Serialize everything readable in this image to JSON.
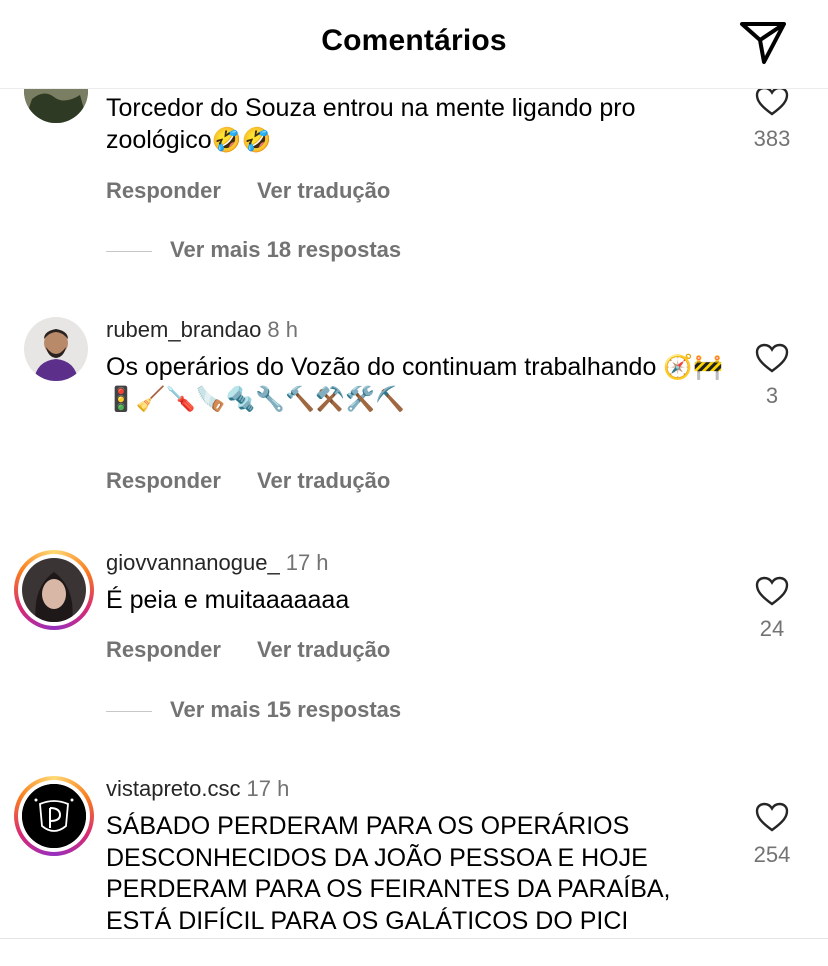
{
  "header": {
    "title": "Comentários"
  },
  "comments": [
    {
      "text": "Torcedor do Souza entrou na mente ligando pro zoológico",
      "emoji": "🤣🤣",
      "reply_label": "Responder",
      "translate_label": "Ver tradução",
      "likes": "383",
      "avatar_colors": [
        "#3c4a2c",
        "#6b6e52"
      ]
    },
    {
      "user": "rubem_brandao",
      "time": "8 h",
      "text": "Os operários do Vozão do continuam trabalhando",
      "emoji": "🧭🚧🚦🧹🪛🪚🔩🔧🔨⚒️🛠️⛏️",
      "reply_label": "Responder",
      "translate_label": "Ver tradução",
      "likes": "3"
    },
    {
      "user": "giovvannanogue_",
      "time": "17 h",
      "text": "É peia e muitaaaaaaa",
      "reply_label": "Responder",
      "translate_label": "Ver tradução",
      "likes": "24"
    },
    {
      "user": "vistapreto.csc",
      "time": "17 h",
      "text": "SÁBADO PERDERAM PARA OS OPERÁRIOS DESCONHECIDOS DA JOÃO PESSOA E HOJE PERDERAM PARA OS FEIRANTES DA PARAÍBA, ESTÁ DIFÍCIL PARA OS GALÁTICOS DO PICI",
      "likes": "254"
    }
  ],
  "replies": [
    {
      "label": "Ver mais 18 respostas"
    },
    {
      "label": "Ver mais 15 respostas"
    }
  ],
  "icons": {
    "share": "paper-plane-icon",
    "like": "heart-outline-icon"
  },
  "colors": {
    "secondary_text": "#737373",
    "story_ring": "#d62976"
  }
}
